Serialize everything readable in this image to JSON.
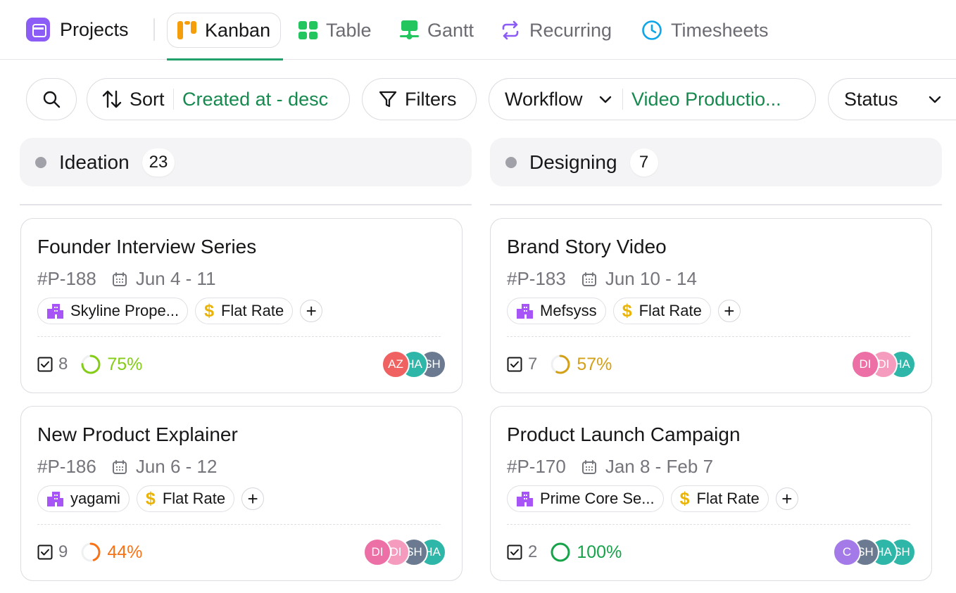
{
  "app": {
    "title": "Projects"
  },
  "tabs": [
    {
      "label": "Kanban",
      "active": true
    },
    {
      "label": "Table"
    },
    {
      "label": "Gantt"
    },
    {
      "label": "Recurring"
    },
    {
      "label": "Timesheets"
    }
  ],
  "toolbar": {
    "sort_label": "Sort",
    "sort_value": "Created at - desc",
    "filters_label": "Filters",
    "workflow_label": "Workflow",
    "workflow_value": "Video Productio...",
    "status_label": "Status"
  },
  "columns": [
    {
      "name": "Ideation",
      "count": "23",
      "cards": [
        {
          "title": "Founder Interview Series",
          "id": "#P-188",
          "dates": "Jun 4 - 11",
          "client": "Skyline Prope...",
          "billing": "Flat Rate",
          "tasks": "8",
          "progress": "75%",
          "progress_value": 0.75,
          "progress_color": "#84cc16",
          "assignees": [
            {
              "initials": "AZ",
              "color": "#f06262"
            },
            {
              "initials": "HA",
              "color": "#2eb6a8"
            },
            {
              "initials": "SH",
              "color": "#6b7a90"
            }
          ]
        },
        {
          "title": "New Product Explainer",
          "id": "#P-186",
          "dates": "Jun 6 - 12",
          "client": "yagami",
          "billing": "Flat Rate",
          "tasks": "9",
          "progress": "44%",
          "progress_value": 0.44,
          "progress_color": "#f97316",
          "assignees": [
            {
              "initials": "DI",
              "color": "#ec6fa5"
            },
            {
              "initials": "DI",
              "color": "#f59bbd"
            },
            {
              "initials": "SH",
              "color": "#6b7a90"
            },
            {
              "initials": "HA",
              "color": "#2eb6a8"
            }
          ]
        }
      ]
    },
    {
      "name": "Designing",
      "count": "7",
      "cards": [
        {
          "title": "Brand Story Video",
          "id": "#P-183",
          "dates": "Jun 10 - 14",
          "client": "Mefsyss",
          "billing": "Flat Rate",
          "tasks": "7",
          "progress": "57%",
          "progress_value": 0.57,
          "progress_color": "#d4a017",
          "assignees": [
            {
              "initials": "DI",
              "color": "#ec6fa5"
            },
            {
              "initials": "DI",
              "color": "#f59bbd"
            },
            {
              "initials": "HA",
              "color": "#2eb6a8"
            }
          ]
        },
        {
          "title": "Product Launch Campaign",
          "id": "#P-170",
          "dates": "Jan 8 - Feb 7",
          "client": "Prime Core Se...",
          "billing": "Flat Rate",
          "tasks": "2",
          "progress": "100%",
          "progress_value": 1.0,
          "progress_color": "#16a34a",
          "assignees": [
            {
              "initials": "C",
              "color": "#a47ae8"
            },
            {
              "initials": "SH",
              "color": "#6b7a90"
            },
            {
              "initials": "HA",
              "color": "#2eb6a8"
            },
            {
              "initials": "SH",
              "color": "#2eb6a8"
            }
          ]
        }
      ]
    }
  ]
}
